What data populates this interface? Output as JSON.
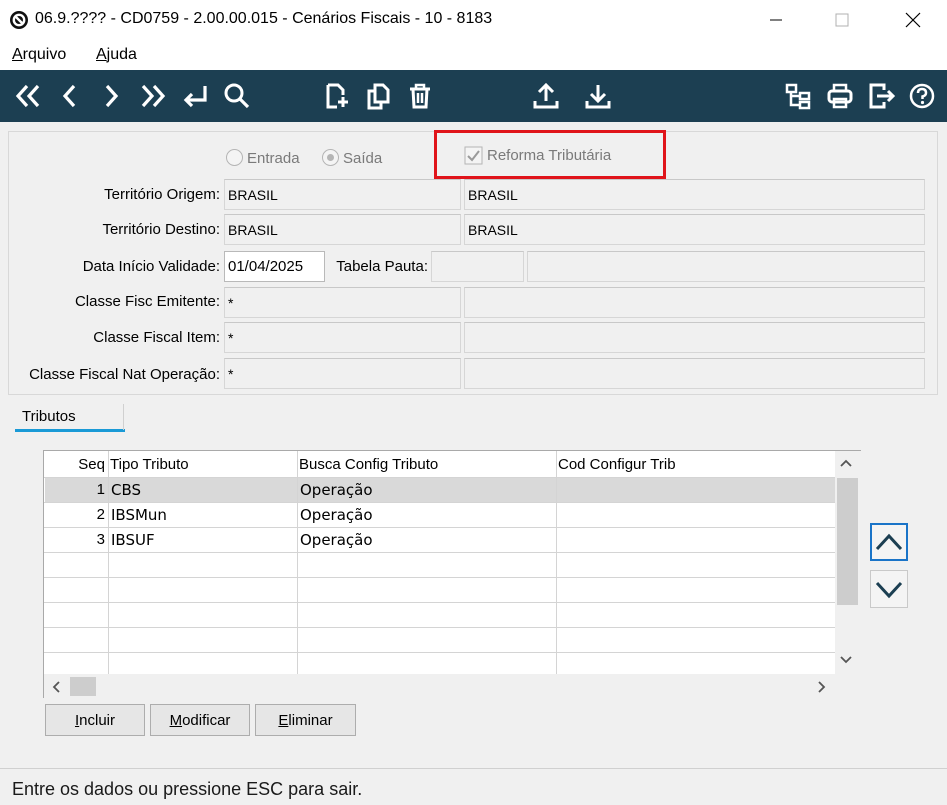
{
  "window": {
    "title": "06.9.???? - CD0759 - 2.00.00.015 - Cenários Fiscais - 10 - 8183",
    "minimize_glyph": "—",
    "maximize_glyph": "☐",
    "close_glyph": "✕"
  },
  "menu": {
    "items": [
      {
        "accel": "A",
        "rest": "rquivo"
      },
      {
        "accel": "A",
        "rest": "juda"
      }
    ]
  },
  "toolbar": {
    "icons": [
      "first-record-icon",
      "previous-record-icon",
      "next-record-icon",
      "last-record-icon",
      "return-icon",
      "search-icon",
      "new-document-icon",
      "copy-icon",
      "delete-icon",
      "upload-icon",
      "download-icon",
      "tree-icon",
      "print-icon",
      "exit-icon",
      "help-icon"
    ]
  },
  "form": {
    "radio_entrada": "Entrada",
    "radio_saida": "Saída",
    "reforma_checkbox": "Reforma Tributária",
    "territorio_origem_label": "Território Origem:",
    "territorio_origem_value": "BRASIL",
    "territorio_origem_desc": "BRASIL",
    "territorio_destino_label": "Território Destino:",
    "territorio_destino_value": "BRASIL",
    "territorio_destino_desc": "BRASIL",
    "data_inicio_label": "Data Início Validade:",
    "data_inicio_value": "01/04/2025",
    "tabela_pauta_label": "Tabela Pauta:",
    "tabela_pauta_value": "",
    "tabela_pauta_desc": "",
    "classe_emitente_label": "Classe Fisc Emitente:",
    "classe_emitente_value": "*",
    "classe_item_label": "Classe Fiscal Item:",
    "classe_item_value": "*",
    "classe_nat_label": "Classe Fiscal Nat Operação:",
    "classe_nat_value": "*"
  },
  "tabs": {
    "tributos": "Tributos"
  },
  "grid": {
    "columns": [
      "Seq",
      "Tipo Tributo",
      "Busca Config Tributo",
      "Cod Configur Trib"
    ],
    "rows": [
      {
        "seq": "1",
        "tipo": "CBS",
        "busca": "Operação",
        "cod": ""
      },
      {
        "seq": "2",
        "tipo": "IBSMun",
        "busca": "Operação",
        "cod": ""
      },
      {
        "seq": "3",
        "tipo": "IBSUF",
        "busca": "Operação",
        "cod": ""
      }
    ]
  },
  "buttons": {
    "incluir": {
      "accel": "I",
      "rest": "ncluir"
    },
    "modificar": {
      "accel": "M",
      "rest": "odificar"
    },
    "eliminar": {
      "accel": "E",
      "rest": "liminar"
    }
  },
  "status": {
    "text": "Entre os dados ou pressione ESC para sair."
  }
}
